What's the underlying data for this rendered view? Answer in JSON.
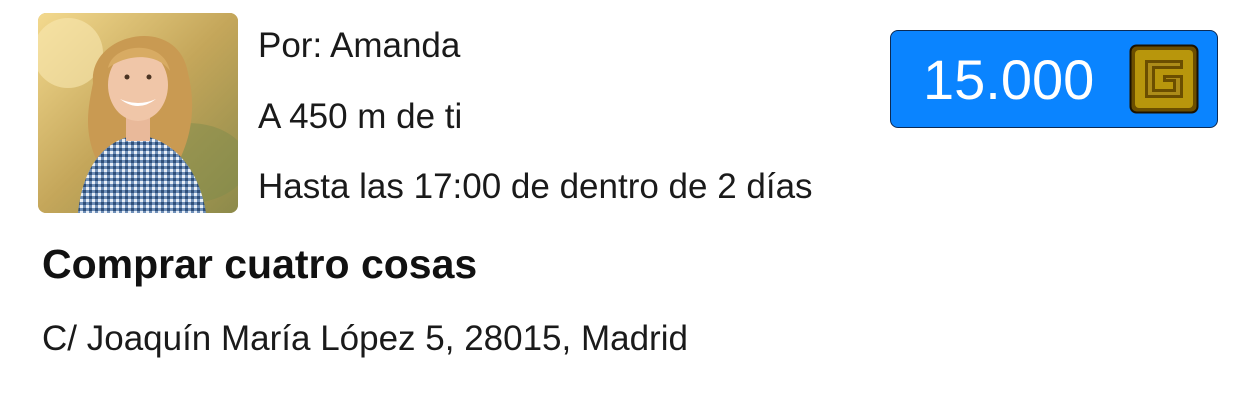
{
  "task": {
    "author": "Por: Amanda",
    "distance": "A 450 m de ti",
    "deadline": "Hasta las 17:00 de dentro de 2 días",
    "title": "Comprar cuatro cosas",
    "address": "C/ Joaquín María López 5, 28015, Madrid"
  },
  "price": {
    "amount": "15.000",
    "currency_icon": "gold-coin-icon"
  },
  "avatar": {
    "icon": "user-photo"
  },
  "colors": {
    "badge_background": "#0a84ff",
    "badge_border": "#0b2a55",
    "badge_text": "#ffffff",
    "coin_fill": "#b8960c",
    "coin_dark": "#6b4e00",
    "text": "#1a1a1a"
  }
}
